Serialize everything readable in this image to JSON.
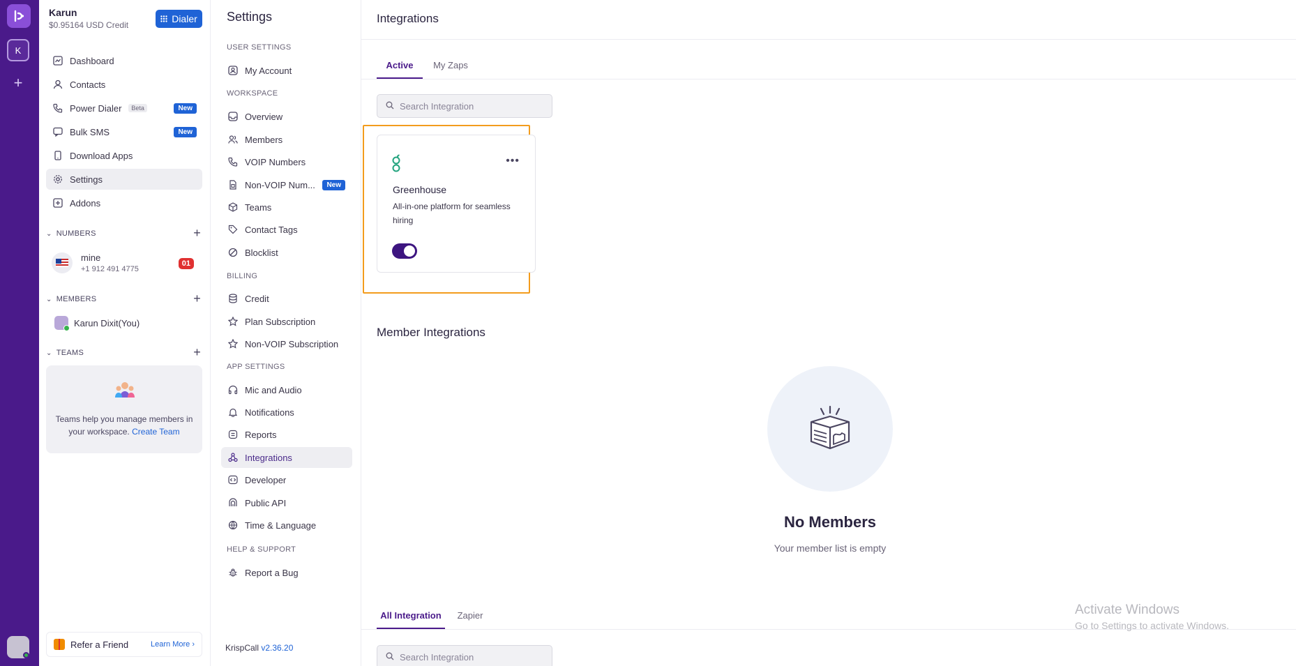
{
  "rail": {
    "workspace_initial": "K"
  },
  "account": {
    "name": "Karun",
    "credit": "$0.95164 USD Credit",
    "dialer_label": "Dialer"
  },
  "nav": {
    "dashboard": "Dashboard",
    "contacts": "Contacts",
    "power_dialer": "Power Dialer",
    "power_dialer_badge": "Beta",
    "power_dialer_new": "New",
    "bulk_sms": "Bulk SMS",
    "bulk_sms_new": "New",
    "download_apps": "Download Apps",
    "settings": "Settings",
    "addons": "Addons"
  },
  "numbers": {
    "header": "NUMBERS",
    "name": "mine",
    "number": "+1 912 491 4775",
    "count": "01"
  },
  "members": {
    "header": "MEMBERS",
    "name": "Karun Dixit(You)"
  },
  "teams": {
    "header": "TEAMS",
    "empty_text": "Teams help you manage members in your workspace.",
    "create_link": "Create Team"
  },
  "refer": {
    "label": "Refer a Friend",
    "learn_more": "Learn More"
  },
  "settings": {
    "title": "Settings",
    "user_settings": "USER SETTINGS",
    "my_account": "My Account",
    "workspace": "WORKSPACE",
    "overview": "Overview",
    "members": "Members",
    "voip_numbers": "VOIP Numbers",
    "non_voip_numbers": "Non-VOIP Num...",
    "non_voip_new": "New",
    "teams": "Teams",
    "contact_tags": "Contact Tags",
    "blocklist": "Blocklist",
    "billing": "BILLING",
    "credit": "Credit",
    "plan_subscription": "Plan Subscription",
    "non_voip_subscription": "Non-VOIP Subscription",
    "app_settings": "APP SETTINGS",
    "mic_audio": "Mic and Audio",
    "notifications": "Notifications",
    "reports": "Reports",
    "integrations": "Integrations",
    "developer": "Developer",
    "public_api": "Public API",
    "time_language": "Time & Language",
    "help_support": "HELP & SUPPORT",
    "report_bug": "Report a Bug",
    "version_label": "KrispCall",
    "version": "v2.36.20"
  },
  "main": {
    "title": "Integrations",
    "tabs": [
      "Active",
      "My Zaps"
    ],
    "search_placeholder": "Search Integration",
    "card": {
      "name": "Greenhouse",
      "description": "All-in-one platform for seamless hiring",
      "enabled": true
    },
    "member_integrations": "Member Integrations",
    "empty_title": "No Members",
    "empty_sub": "Your member list is empty",
    "bottom_tabs": [
      "All Integration",
      "Zapier"
    ],
    "bottom_search_placeholder": "Search Integration"
  },
  "watermark": {
    "line1": "Activate Windows",
    "line2": "Go to Settings to activate Windows."
  },
  "colors": {
    "brand": "#4a1a8a",
    "accent": "#1f63d6",
    "highlight": "#f39c1d",
    "greenhouse": "#24a47f"
  }
}
